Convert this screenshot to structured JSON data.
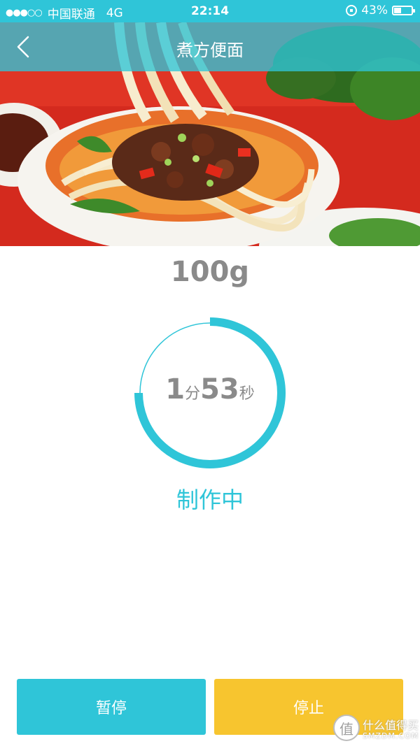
{
  "status_bar": {
    "signal": "●●●○○",
    "carrier": "中国联通",
    "network": "4G",
    "time": "22:14",
    "battery": "43%",
    "battery_level": 0.43
  },
  "nav": {
    "title": "煮方便面"
  },
  "recipe": {
    "weight": "100g"
  },
  "timer": {
    "minutes": "1",
    "minutes_unit": "分",
    "seconds": "53",
    "seconds_unit": "秒",
    "progress": 0.75
  },
  "status": "制作中",
  "buttons": {
    "pause": "暂停",
    "stop": "停止"
  },
  "watermark": {
    "line1": "什么值得买",
    "line2": "SMZDM.COM",
    "logo_char": "值"
  },
  "colors": {
    "accent": "#2fc5d8",
    "stop": "#f7c52f",
    "text_gray": "#8a8a8a"
  }
}
